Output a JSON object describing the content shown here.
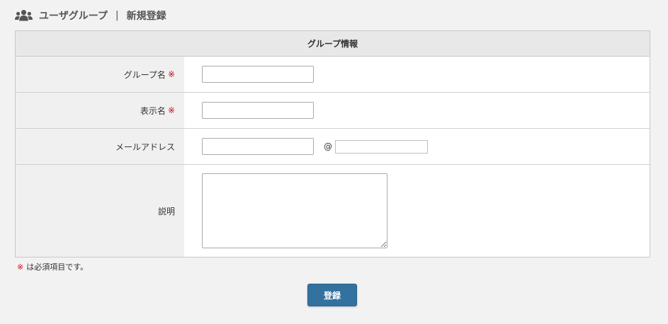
{
  "header": {
    "icon": "users-icon",
    "title": "ユーザグループ",
    "separator": "|",
    "subtitle": "新規登録"
  },
  "form": {
    "section_title": "グループ情報",
    "required_mark": "※",
    "fields": {
      "group_name": {
        "label": "グループ名",
        "required": true,
        "value": ""
      },
      "display_name": {
        "label": "表示名",
        "required": true,
        "value": ""
      },
      "email": {
        "label": "メールアドレス",
        "at_symbol": "@",
        "local_value": "",
        "domain_value": ""
      },
      "description": {
        "label": "説明",
        "value": ""
      }
    }
  },
  "note": {
    "mark": "※",
    "text": "は必須項目です。"
  },
  "submit": {
    "label": "登録"
  },
  "colors": {
    "required": "#d0021b",
    "button": "#33719f",
    "label_bg": "#f0f0f0",
    "section_bg": "#e8e8e8"
  }
}
